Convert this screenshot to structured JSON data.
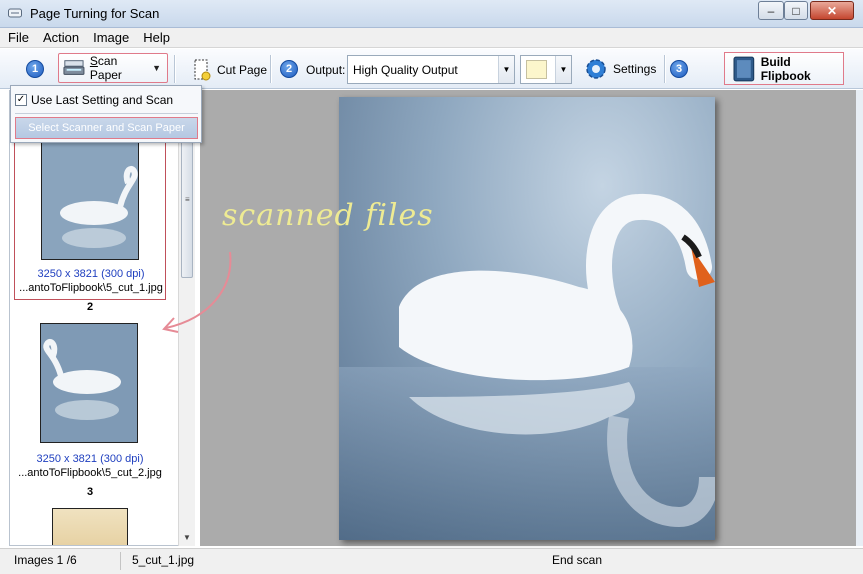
{
  "window": {
    "title": "Page Turning for Scan",
    "minimize": "–",
    "maximize": "□",
    "close": "✕"
  },
  "menu": [
    "File",
    "Action",
    "Image",
    "Help"
  ],
  "toolbar": {
    "step1": "1",
    "scan_paper": "Scan Paper",
    "cut_page": "Cut Page",
    "step2": "2",
    "output_label": "Output:",
    "output_value": "High Quality Output",
    "settings": "Settings",
    "step3": "3",
    "build_flipbook": "Build Flipbook",
    "swatch_color": "#fcf6cc"
  },
  "scan_dropdown": {
    "item1": "Use Last Setting and Scan",
    "item1_checked": "✓",
    "item2": "Select Scanner and Scan Paper"
  },
  "thumbnails": [
    {
      "dpi": "3250 x 3821 (300 dpi)",
      "path": "...antoToFlipbook\\5_cut_1.jpg",
      "number": "2"
    },
    {
      "dpi": "3250 x 3821 (300 dpi)",
      "path": "...antoToFlipbook\\5_cut_2.jpg",
      "number": "3"
    }
  ],
  "annotation": "scanned files",
  "status": {
    "images": "Images 1 /6",
    "file": "5_cut_1.jpg",
    "state": "End scan"
  }
}
